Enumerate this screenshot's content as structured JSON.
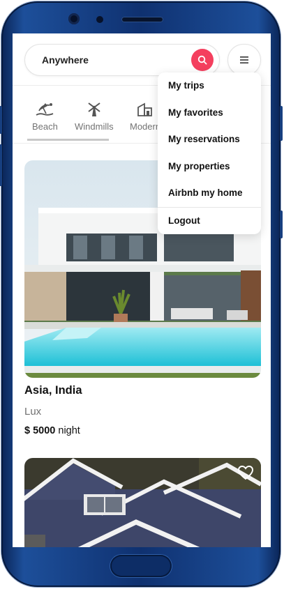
{
  "search": {
    "label": "Anywhere"
  },
  "categories": [
    {
      "label": "Beach",
      "icon": "beach-icon"
    },
    {
      "label": "Windmills",
      "icon": "windmill-icon"
    },
    {
      "label": "Modern",
      "icon": "modern-house-icon"
    }
  ],
  "menu": {
    "items": [
      "My trips",
      "My favorites",
      "My reservations",
      "My properties",
      "Airbnb my home"
    ],
    "logout": "Logout"
  },
  "listings": [
    {
      "location": "Asia, India",
      "category": "Lux",
      "price": "$ 5000",
      "unit": "night"
    }
  ],
  "colors": {
    "accent": "#f43f5e",
    "frame": "#0f3170",
    "pool": "#22c5d8"
  }
}
